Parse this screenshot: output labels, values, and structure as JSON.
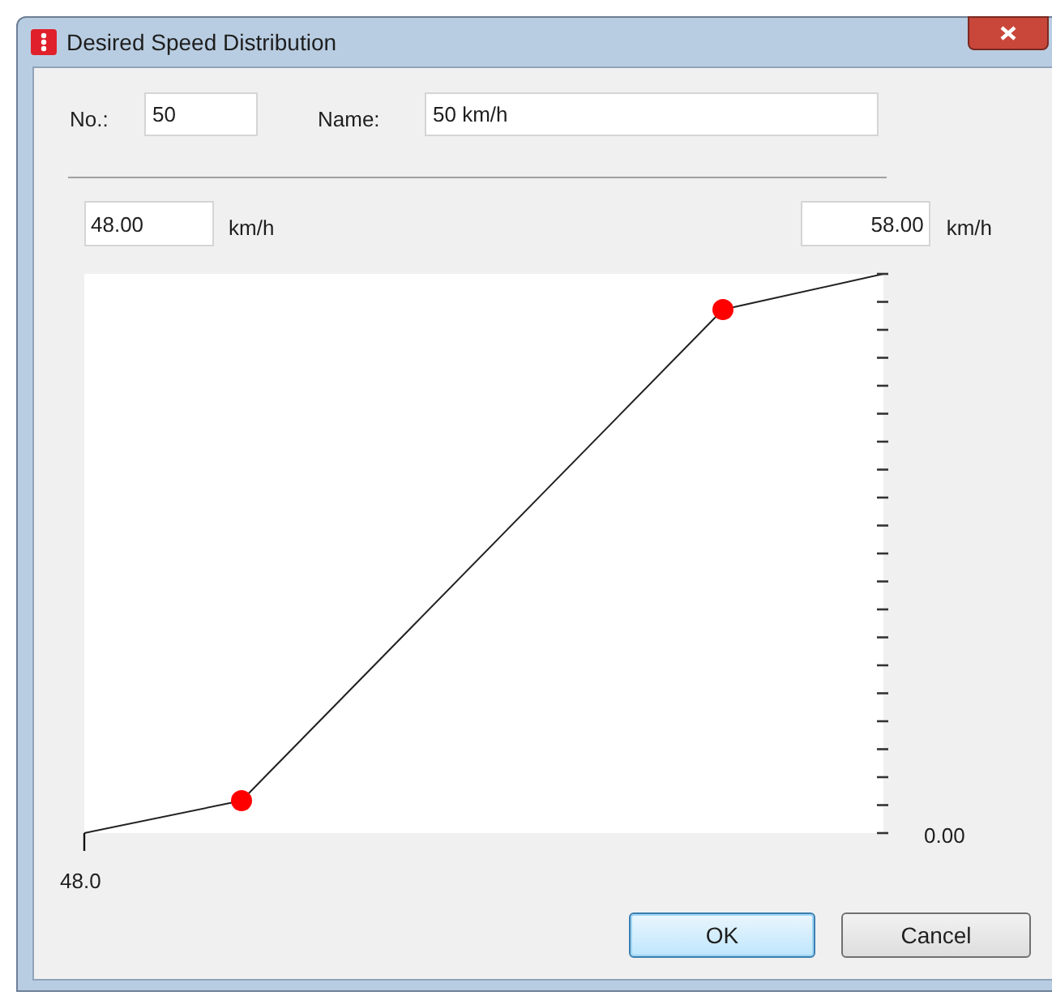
{
  "window": {
    "title": "Desired Speed Distribution"
  },
  "fields": {
    "number": {
      "label": "No.:",
      "value": "50"
    },
    "name": {
      "label": "Name:",
      "value": "50 km/h"
    }
  },
  "range": {
    "min": {
      "value": "48.00",
      "unit": "km/h"
    },
    "max": {
      "value": "58.00",
      "unit": "km/h"
    }
  },
  "plot": {
    "x_start_label": "48.0",
    "y_min_label": "0.00"
  },
  "buttons": [
    {
      "label": "OK",
      "default": true
    },
    {
      "label": "Cancel",
      "default": false
    }
  ]
}
